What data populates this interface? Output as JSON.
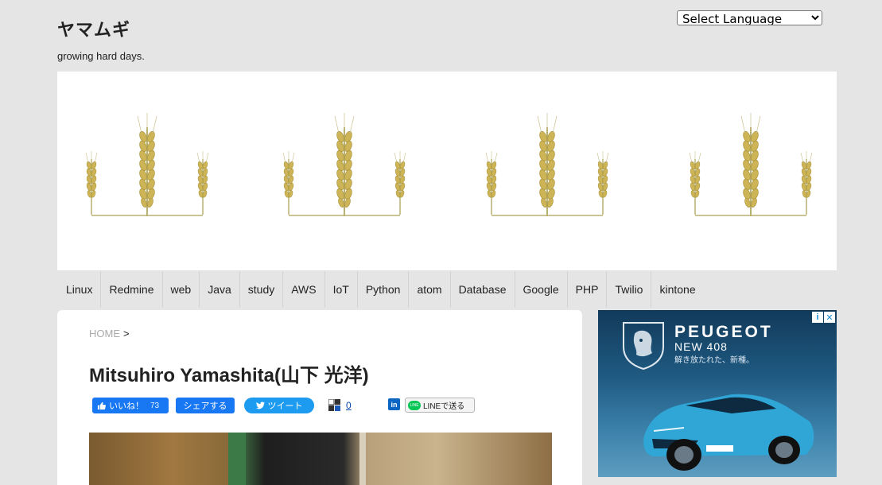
{
  "site": {
    "title": "ヤマムギ",
    "tagline": "growing hard days."
  },
  "language_select": {
    "selected": "Select Language"
  },
  "nav": {
    "items": [
      "Linux",
      "Redmine",
      "web",
      "Java",
      "study",
      "AWS",
      "IoT",
      "Python",
      "atom",
      "Database",
      "Google",
      "PHP",
      "Twilio",
      "kintone"
    ]
  },
  "breadcrumb": {
    "home": "HOME",
    "separator": ">"
  },
  "page": {
    "title": "Mitsuhiro Yamashita(山下 光洋)"
  },
  "share": {
    "facebook_like": "いいね！",
    "facebook_like_count": "73",
    "facebook_share": "シェアする",
    "tweet": "ツイート",
    "hatena_count": "0",
    "linkedin_label": "in",
    "line_icon": "LINE",
    "line": "LINEで送る"
  },
  "ad": {
    "brand": "PEUGEOT",
    "model": "NEW 408",
    "tagline": "解き放たれた、新種。",
    "info_icon": "i",
    "close_icon": "✕"
  },
  "colors": {
    "background": "#e5e5e5",
    "facebook": "#1877f2",
    "twitter": "#1d9bf0",
    "line": "#06c755",
    "linkedin": "#0a66c2",
    "wheat": "#c9b45a"
  }
}
